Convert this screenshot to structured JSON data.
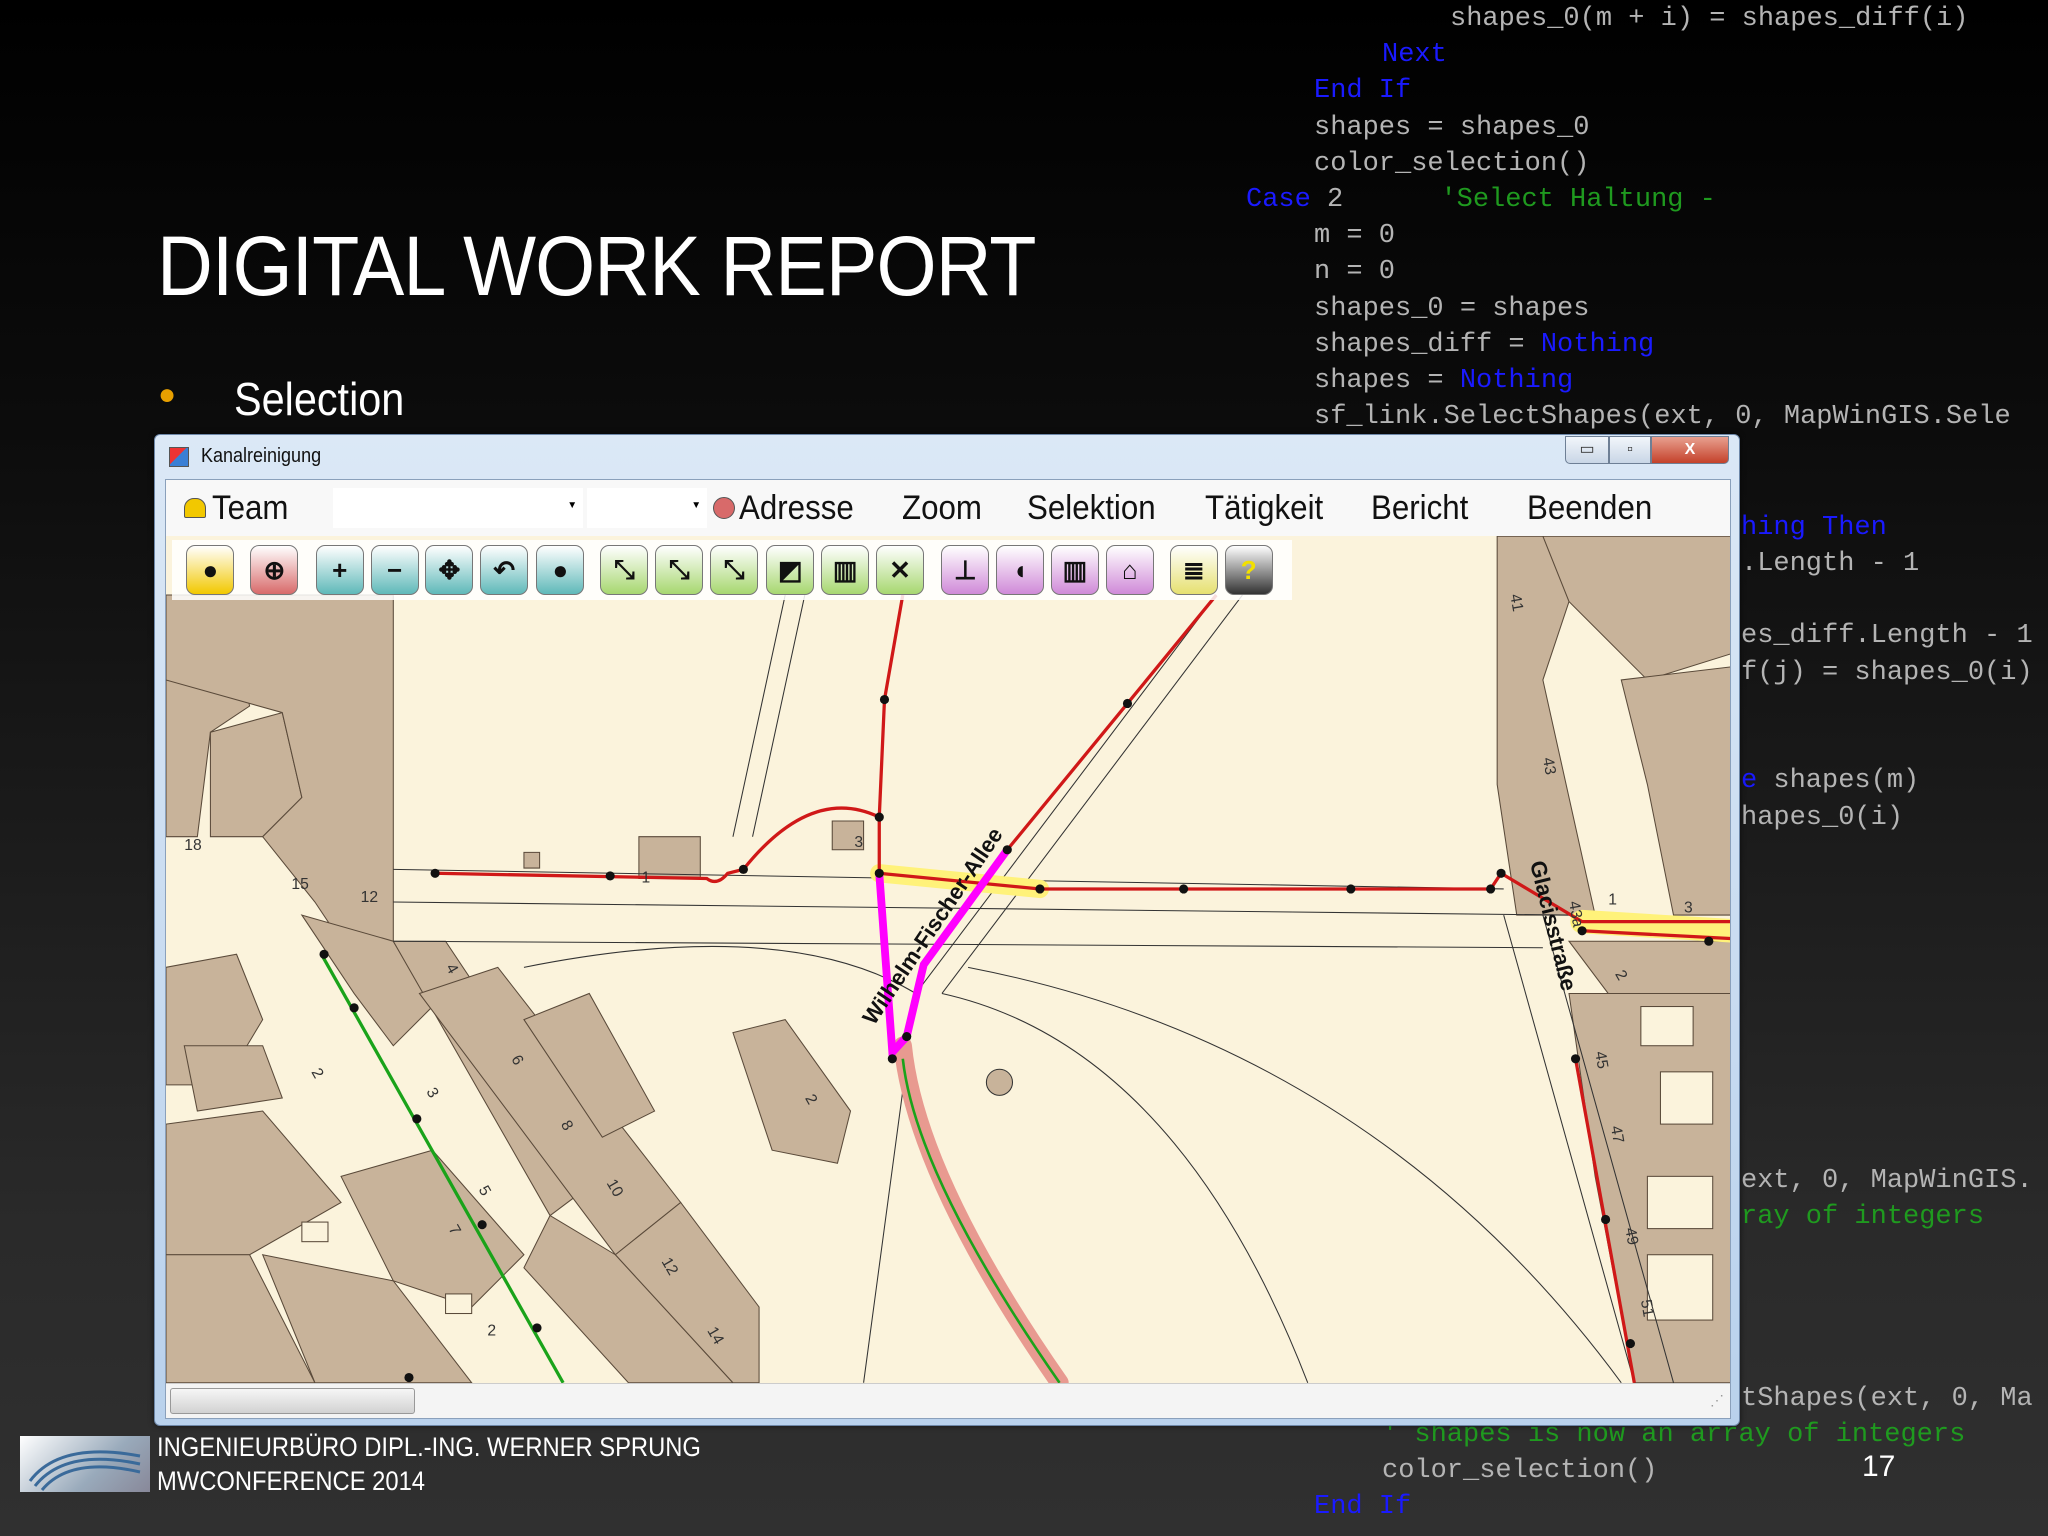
{
  "code_lines": [
    {
      "text": "shapes_0(m + i) = shapes_diff(i)",
      "kind": "plain"
    },
    {
      "text": "Next",
      "kind": "kw"
    },
    {
      "text": "End If",
      "kind": "kw"
    },
    {
      "text": "shapes = shapes_0",
      "kind": "plain"
    },
    {
      "text": "color_selection()",
      "kind": "plain"
    },
    {
      "text": "Case",
      "kind": "kw",
      "rest": " 2      ",
      "comment": "'Select Haltung -"
    },
    {
      "text": "m = 0",
      "kind": "plain"
    },
    {
      "text": "n = 0",
      "kind": "plain"
    },
    {
      "text": "shapes_0 = shapes",
      "kind": "plain"
    },
    {
      "text": "shapes_diff = ",
      "kind": "plain",
      "kw": "Nothing"
    },
    {
      "text": "shapes = ",
      "kind": "plain",
      "kw": "Nothing"
    },
    {
      "text": "sf_link.SelectShapes(ext, 0, MapWinGIS.Sele",
      "kind": "plain"
    }
  ],
  "code_fragments": [
    {
      "text": "hing Then",
      "kind": "kw"
    },
    {
      "text": ".Length - 1",
      "kind": "plain"
    },
    {
      "text": "es_diff.Length - 1",
      "kind": "plain"
    },
    {
      "text": "f(j) = shapes_0(i)",
      "kind": "plain"
    },
    {
      "text": "e",
      "kind": "kw",
      "rest": " shapes(m)"
    },
    {
      "text": "hapes_0(i)",
      "kind": "plain"
    },
    {
      "text": "ext, 0, MapWinGIS.",
      "kind": "plain"
    },
    {
      "text": "ray of integers",
      "kind": "cm"
    },
    {
      "text": "tShapes(ext, 0, Ma",
      "kind": "plain"
    },
    {
      "text": "' shapes is now an array of integers",
      "kind": "cm"
    },
    {
      "text": "color_selection()",
      "kind": "plain"
    },
    {
      "text": "End If",
      "kind": "kw"
    }
  ],
  "slide": {
    "title": "DIGITAL WORK REPORT",
    "bullet": "Selection",
    "footer_line1": "INGENIEURBÜRO DIPL.-ING. WERNER SPRUNG",
    "footer_line2": "MWCONFERENCE 2014",
    "page_number": "17"
  },
  "window": {
    "title": "Kanalreinigung",
    "minimize": "▭",
    "maximize": "▫",
    "close": "X"
  },
  "menu": {
    "team": "Team",
    "adresse": "Adresse",
    "zoom": "Zoom",
    "selektion": "Selektion",
    "taetigkeit": "Tätigkeit",
    "bericht": "Bericht",
    "beenden": "Beenden",
    "combo1": "",
    "combo2": ""
  },
  "toolbar": [
    {
      "name": "team-helmet",
      "icon": "helmet-icon",
      "glyph": "●",
      "color": "#f2c800"
    },
    {
      "name": "address-target",
      "icon": "crosshair-icon",
      "glyph": "⊕",
      "color": "#d86a6a"
    },
    {
      "name": "zoom-in",
      "icon": "zoom-in-icon",
      "glyph": "+",
      "color": "#5fb9b9"
    },
    {
      "name": "zoom-out",
      "icon": "zoom-out-icon",
      "glyph": "−",
      "color": "#5fb9b9"
    },
    {
      "name": "pan",
      "icon": "move-icon",
      "glyph": "✥",
      "color": "#5fb9b9"
    },
    {
      "name": "rotate",
      "icon": "rotate-icon",
      "glyph": "↶",
      "color": "#5fb9b9"
    },
    {
      "name": "full-extent",
      "icon": "dot-icon",
      "glyph": "●",
      "color": "#5fb9b9"
    },
    {
      "name": "select-pipe",
      "icon": "pipe-select-icon",
      "glyph": "⤡",
      "color": "#a7d76f"
    },
    {
      "name": "add-pipe",
      "icon": "pipe-add-icon",
      "glyph": "⤡",
      "color": "#a7d76f"
    },
    {
      "name": "remove-pipe",
      "icon": "pipe-remove-icon",
      "glyph": "⤡",
      "color": "#a7d76f"
    },
    {
      "name": "select-manhole",
      "icon": "manhole-select-icon",
      "glyph": "◩",
      "color": "#a7d76f"
    },
    {
      "name": "select-grid",
      "icon": "grid-select-icon",
      "glyph": "▥",
      "color": "#a7d76f"
    },
    {
      "name": "clear-selection",
      "icon": "clear-selection-icon",
      "glyph": "✕",
      "color": "#a7d76f"
    },
    {
      "name": "manhole",
      "icon": "manhole-icon",
      "glyph": "⊥",
      "color": "#d08ad8"
    },
    {
      "name": "camera",
      "icon": "camera-icon",
      "glyph": "◖",
      "color": "#d08ad8"
    },
    {
      "name": "grid",
      "icon": "grid-icon",
      "glyph": "▥",
      "color": "#d08ad8"
    },
    {
      "name": "house",
      "icon": "house-icon",
      "glyph": "⌂",
      "color": "#d08ad8"
    },
    {
      "name": "report",
      "icon": "scroll-icon",
      "glyph": "≣",
      "color": "#e6e070"
    },
    {
      "name": "help",
      "icon": "help-icon",
      "glyph": "?",
      "color": "#333333"
    }
  ],
  "map": {
    "street1": "Wilhelm-Fischer-Allee",
    "street2": "Glacisstraße",
    "house_numbers": [
      "18",
      "15",
      "1",
      "3",
      "41",
      "43",
      "43a",
      "1",
      "3",
      "2",
      "45",
      "47",
      "49",
      "51",
      "4",
      "6",
      "8",
      "10",
      "12",
      "14",
      "2",
      "3",
      "5",
      "7",
      "2",
      "2",
      "12"
    ]
  },
  "colors": {
    "pipe": "#d01818",
    "selected": "#ff00ff",
    "highlight": "#fff27a",
    "building": "#c8b39a",
    "ground": "#fbf3dc",
    "green_pipe": "#1aa31a"
  }
}
